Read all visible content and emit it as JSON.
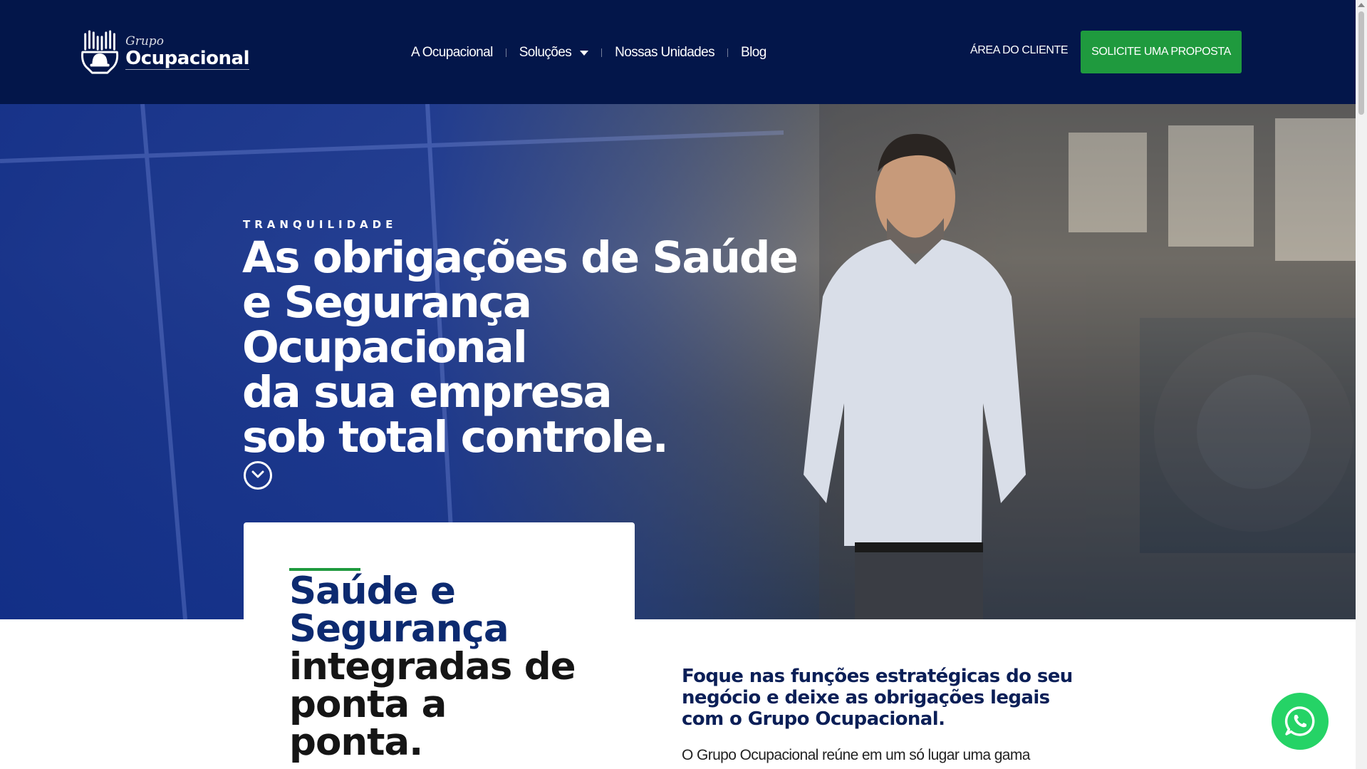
{
  "header": {
    "logo": {
      "small": "Grupo",
      "big": "Ocupacional"
    },
    "nav": [
      {
        "label": "A Ocupacional"
      },
      {
        "label": "Soluções"
      },
      {
        "label": "Nossas Unidades"
      },
      {
        "label": "Blog"
      }
    ],
    "client_area": "ÁREA DO CLIENTE",
    "cta": "SOLICITE UMA PROPOSTA"
  },
  "hero": {
    "kicker": "TRANQUILIDADE",
    "title_lines": [
      "As obrigações de Saúde",
      "e Segurança Ocupacional",
      "da sua empresa",
      "sob total controle."
    ]
  },
  "card": {
    "title_accent": "Saúde e Segurança",
    "title_rest": "integradas de ponta a ponta."
  },
  "intro": {
    "lead": "Foque nas funções estratégicas do seu negócio e deixe as obrigações legais com o Grupo Ocupacional.",
    "body": "O Grupo Ocupacional reúne em um só lugar uma gama"
  },
  "colors": {
    "header_bg": "#03164a",
    "accent_green": "#1f9a3e",
    "title_blue": "#0c2a70",
    "whatsapp_green": "#25d366"
  },
  "icons": {
    "scroll": "chevron-down-circle-icon",
    "whatsapp": "whatsapp-icon",
    "logo": "hands-helmet-logo-icon"
  }
}
